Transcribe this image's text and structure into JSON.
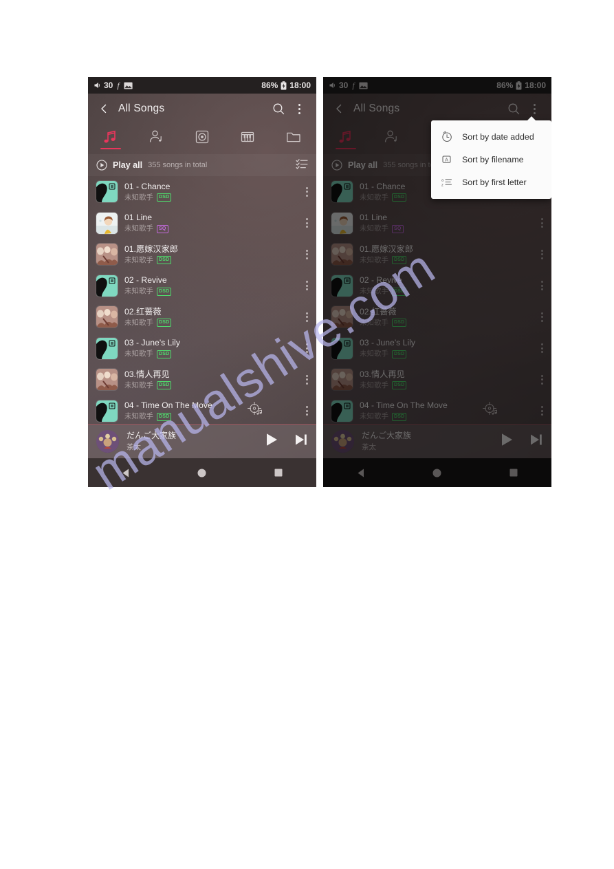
{
  "watermark": {
    "text": "manualshive.com"
  },
  "status_bar": {
    "volume_icon": "speaker-icon",
    "volume": "30",
    "font_icon": "f-glyph-icon",
    "picture_icon": "picture-icon",
    "battery_percent": "86%",
    "battery_icon": "battery-icon",
    "time": "18:00"
  },
  "app_bar": {
    "back_icon": "chevron-left-icon",
    "title": "All Songs",
    "search_icon": "search-icon",
    "overflow_icon": "overflow-menu-icon"
  },
  "tabs": [
    {
      "name": "tab-songs",
      "icon": "music-note-icon",
      "active": true
    },
    {
      "name": "tab-artists",
      "icon": "artist-icon",
      "active": false
    },
    {
      "name": "tab-albums",
      "icon": "album-disc-icon",
      "active": false
    },
    {
      "name": "tab-genres",
      "icon": "piano-icon",
      "active": false
    },
    {
      "name": "tab-folders",
      "icon": "folder-icon",
      "active": false
    }
  ],
  "play_all": {
    "play_icon": "play-circle-icon",
    "label": "Play all",
    "count": "355 songs in total",
    "list_icon": "checklist-icon"
  },
  "songs": [
    {
      "title": "01 - Chance",
      "artist": "未知歌手",
      "quality": "DSD",
      "art": "teal-portrait",
      "more_icon": "overflow-menu-icon"
    },
    {
      "title": "01 Line",
      "artist": "未知歌手",
      "quality": "SQ",
      "art": "anime-girl",
      "more_icon": "overflow-menu-icon"
    },
    {
      "title": "01.愿嫁汉家郎",
      "artist": "未知歌手",
      "quality": "DSD",
      "art": "photo-group",
      "more_icon": "overflow-menu-icon"
    },
    {
      "title": "02 - Revive",
      "artist": "未知歌手",
      "quality": "DSD",
      "art": "teal-portrait",
      "more_icon": "overflow-menu-icon"
    },
    {
      "title": "02.红蔷薇",
      "artist": "未知歌手",
      "quality": "DSD",
      "art": "photo-group",
      "more_icon": "overflow-menu-icon"
    },
    {
      "title": "03 - June's Lily",
      "artist": "未知歌手",
      "quality": "DSD",
      "art": "teal-portrait",
      "more_icon": "overflow-menu-icon"
    },
    {
      "title": "03.情人再见",
      "artist": "未知歌手",
      "quality": "DSD",
      "art": "photo-group",
      "more_icon": "overflow-menu-icon"
    },
    {
      "title": "04 - Time On The Move",
      "artist": "未知歌手",
      "quality": "DSD",
      "art": "teal-portrait",
      "more_icon": "overflow-menu-icon",
      "crosshair_icon": "now-playing-locate-icon"
    }
  ],
  "mini_player": {
    "art": "album-art-circle",
    "title": "だんご大家族",
    "artist": "茶太",
    "play_icon": "play-icon",
    "next_icon": "skip-next-icon"
  },
  "nav_bar": {
    "back_icon": "nav-back-triangle-icon",
    "home_icon": "nav-home-circle-icon",
    "recents_icon": "nav-recents-square-icon"
  },
  "sort_menu": {
    "items": [
      {
        "label": "Sort by date added",
        "icon": "clock-history-icon"
      },
      {
        "label": "Sort by filename",
        "icon": "file-letter-a-icon"
      },
      {
        "label": "Sort by first letter",
        "icon": "az-sort-icon"
      }
    ]
  },
  "colors": {
    "accent": "#e8365c",
    "dsd_badge": "#4fdb6c",
    "sq_badge": "#c66ae0",
    "status_bar_bg": "#242020",
    "nav_bar_bg": "#3a3232"
  }
}
